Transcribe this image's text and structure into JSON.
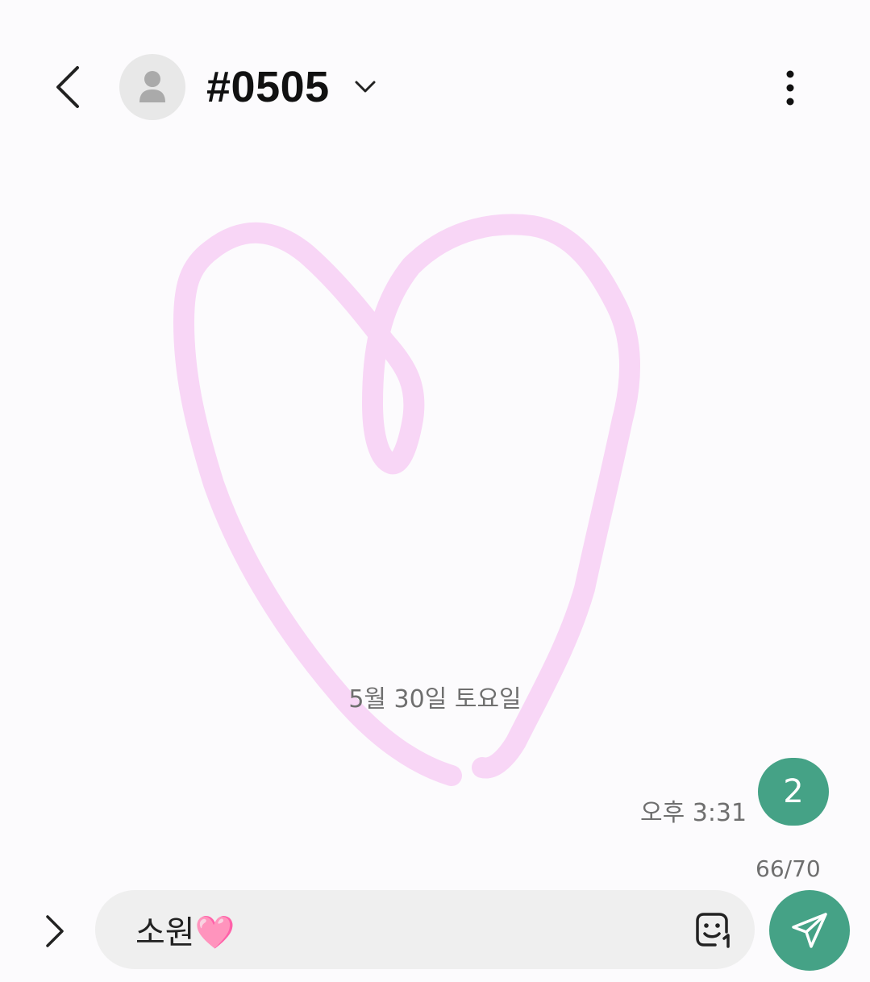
{
  "header": {
    "title": "#0505"
  },
  "conversation": {
    "date_divider": "5월 30일 토요일",
    "message_time": "오후 3:31",
    "unread_badge": "2"
  },
  "composer": {
    "char_count": "66/70",
    "text": "소원🩷"
  },
  "icons": {
    "back": "chevron-left-icon",
    "avatar": "person-icon",
    "dropdown": "chevron-down-icon",
    "more": "more-vertical-icon",
    "expand": "chevron-right-icon",
    "sticker": "emoji-sticker-icon",
    "send": "send-icon"
  },
  "colors": {
    "accent": "#45a286",
    "drawing_stroke": "#f8d6f6",
    "background": "#fcfbfd"
  }
}
